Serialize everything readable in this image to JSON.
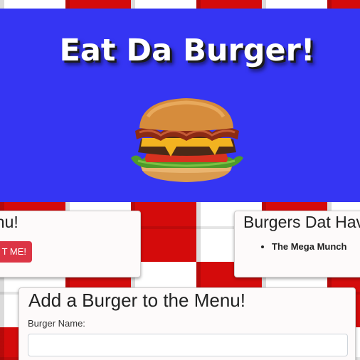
{
  "header": {
    "title": "Eat Da Burger!",
    "image": "burger-image",
    "background_color": "#3535f3"
  },
  "menu_card": {
    "title": "enu!",
    "button_label": "T ME!"
  },
  "devoured_card": {
    "title": "Burgers Dat Hav",
    "items": [
      "The Mega Munch"
    ]
  },
  "add_card": {
    "title": "Add a Burger to the Menu!",
    "field_label": "Burger Name:",
    "field_value": ""
  },
  "colors": {
    "checker_red": "#d40b0b",
    "checker_white": "#ffffff",
    "button_red": "#dc3545"
  }
}
